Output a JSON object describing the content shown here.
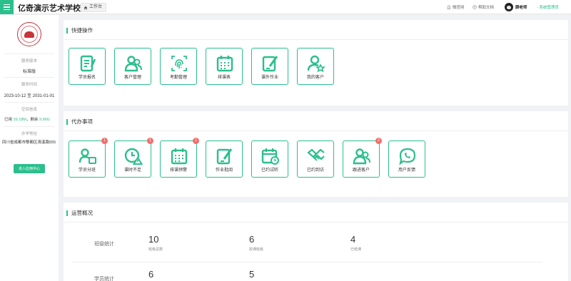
{
  "app": {
    "title": "亿奇演示艺术学校"
  },
  "header": {
    "home_tab": "工作台",
    "links": [
      {
        "label": "微官网",
        "icon": "building-icon"
      },
      {
        "label": "帮助文档",
        "icon": "help-circle-icon"
      }
    ],
    "user": {
      "name": "顾老师",
      "role": "- 系统管理员"
    }
  },
  "sidebar": {
    "version_label": "服务版本",
    "version_value": "标准版",
    "period_label": "服务时间",
    "period_value": "2023-10-12 至 2031-01-01",
    "space_label": "空间信息",
    "space_used_prefix": "已用",
    "space_used": "39.18M",
    "space_remain_prefix": "，剩余",
    "space_remain": "9.96G",
    "address_label": "办学地址",
    "address_value": "四川省成都市郫都区清溪路555",
    "enter_button": "进入应用中心"
  },
  "quick_actions": {
    "title": "快捷操作",
    "items": [
      {
        "label": "学员报名",
        "icon": "signup-form-icon"
      },
      {
        "label": "客户管理",
        "icon": "customers-icon"
      },
      {
        "label": "考勤管理",
        "icon": "fingerprint-icon"
      },
      {
        "label": "排课表",
        "icon": "calendar-grid-icon"
      },
      {
        "label": "课外作业",
        "icon": "homework-pen-icon"
      },
      {
        "label": "我的客户",
        "icon": "user-star-icon"
      }
    ]
  },
  "todos": {
    "title": "代办事项",
    "items": [
      {
        "label": "学员分班",
        "icon": "student-group-icon",
        "badge": "1"
      },
      {
        "label": "课时不足",
        "icon": "clock-warning-icon",
        "badge": "1"
      },
      {
        "label": "排课预警",
        "icon": "calendar-grid-icon",
        "badge": "1"
      },
      {
        "label": "作业批阅",
        "icon": "homework-pen-icon",
        "badge": ""
      },
      {
        "label": "已约试听",
        "icon": "calendar-clock-icon",
        "badge": ""
      },
      {
        "label": "已约到访",
        "icon": "handshake-icon",
        "badge": ""
      },
      {
        "label": "跟进客户",
        "icon": "customers-icon",
        "badge": "2"
      },
      {
        "label": "用户反馈",
        "icon": "feedback-phone-icon",
        "badge": ""
      }
    ]
  },
  "overview": {
    "title": "运营概况",
    "rows": [
      {
        "label": "班级统计",
        "stats": [
          {
            "value": "10",
            "caption": "班级总数"
          },
          {
            "value": "6",
            "caption": "授课班级"
          },
          {
            "value": "4",
            "caption": "已结课"
          }
        ]
      },
      {
        "label": "学员统计",
        "stats": [
          {
            "value": "6",
            "caption": ""
          },
          {
            "value": "5",
            "caption": ""
          }
        ]
      }
    ]
  },
  "colors": {
    "accent": "#2bbf8c",
    "badge": "#f56c6c",
    "logo": "#c7343a"
  }
}
